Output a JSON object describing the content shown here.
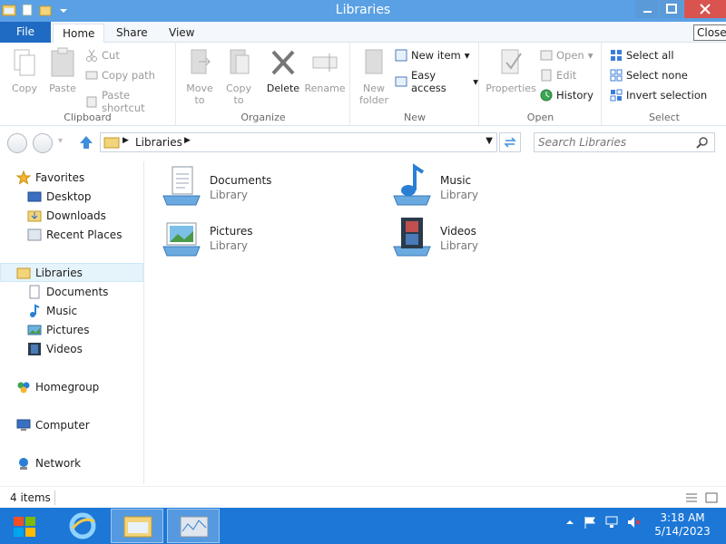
{
  "window": {
    "title": "Libraries",
    "tooltip": "Close"
  },
  "tabs": {
    "file": "File",
    "home": "Home",
    "share": "Share",
    "view": "View"
  },
  "ribbon": {
    "clipboard": {
      "label": "Clipboard",
      "copy": "Copy",
      "paste": "Paste",
      "cut": "Cut",
      "copy_path": "Copy path",
      "paste_shortcut": "Paste shortcut"
    },
    "organize": {
      "label": "Organize",
      "move_to_1": "Move",
      "move_to_2": "to",
      "copy_to_1": "Copy",
      "copy_to_2": "to",
      "delete": "Delete",
      "rename": "Rename"
    },
    "new": {
      "label": "New",
      "new_folder_1": "New",
      "new_folder_2": "folder",
      "new_item": "New item",
      "easy_access": "Easy access"
    },
    "open": {
      "label": "Open",
      "properties": "Properties",
      "open": "Open",
      "edit": "Edit",
      "history": "History"
    },
    "select": {
      "label": "Select",
      "select_all": "Select all",
      "select_none": "Select none",
      "invert": "Invert selection"
    }
  },
  "address": {
    "breadcrumb": "Libraries",
    "search_placeholder": "Search Libraries"
  },
  "navpane": {
    "favorites": "Favorites",
    "desktop": "Desktop",
    "downloads": "Downloads",
    "recent": "Recent Places",
    "libraries": "Libraries",
    "documents": "Documents",
    "music": "Music",
    "pictures": "Pictures",
    "videos": "Videos",
    "homegroup": "Homegroup",
    "computer": "Computer",
    "network": "Network"
  },
  "content": {
    "items": [
      {
        "name": "Documents",
        "type": "Library"
      },
      {
        "name": "Music",
        "type": "Library"
      },
      {
        "name": "Pictures",
        "type": "Library"
      },
      {
        "name": "Videos",
        "type": "Library"
      }
    ]
  },
  "status": {
    "count": "4 items"
  },
  "taskbar": {
    "time": "3:18 AM",
    "date": "5/14/2023"
  },
  "colors": {
    "titlebar": "#5aa0e4",
    "file_tab": "#1f6ac2",
    "taskbar": "#1c77d6",
    "close": "#d9534f"
  }
}
